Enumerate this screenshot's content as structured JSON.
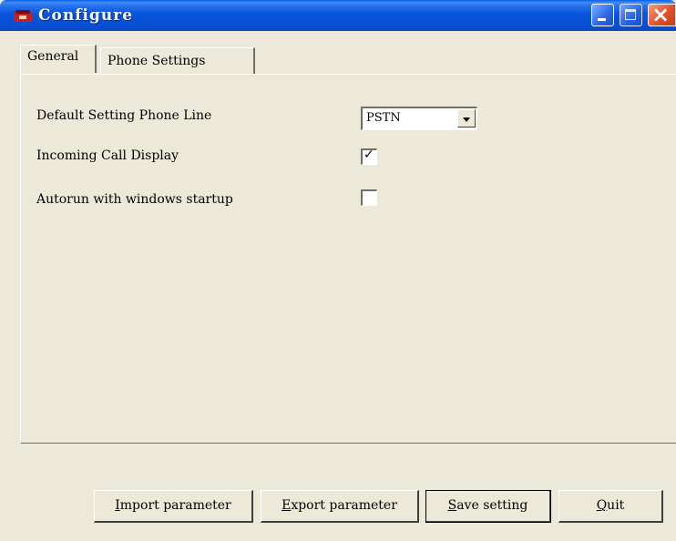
{
  "window": {
    "title": "Configure",
    "icon": "phone-icon",
    "controls": [
      "minimize-icon",
      "maximize-icon",
      "close-icon"
    ]
  },
  "tabs": [
    {
      "label": "General",
      "selected": true
    },
    {
      "label": "Phone Settings",
      "selected": false
    }
  ],
  "general": {
    "phone_line": {
      "label": "Default Setting Phone Line",
      "value": "PSTN"
    },
    "incoming_call": {
      "label": "Incoming Call Display",
      "checked": true
    },
    "autorun": {
      "label": "Autorun with windows startup",
      "checked": false
    }
  },
  "buttons": {
    "import": {
      "mnemonic": "I",
      "rest": "mport parameter"
    },
    "export": {
      "mnemonic": "E",
      "rest": "xport parameter"
    },
    "save": {
      "mnemonic": "S",
      "rest": "ave setting"
    },
    "quit": {
      "mnemonic": "Q",
      "rest": "uit"
    }
  },
  "colors": {
    "titlebar": "#0855DD",
    "face": "#ECE9D8",
    "close": "#E0502C"
  }
}
